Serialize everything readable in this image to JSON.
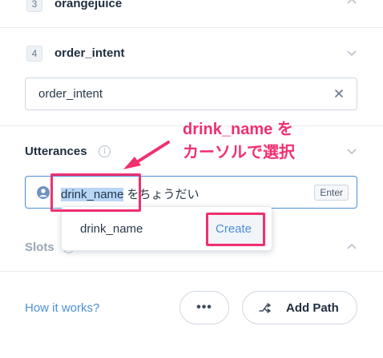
{
  "steps": [
    {
      "number": "3",
      "name": "orangejuice"
    },
    {
      "number": "4",
      "name": "order_intent"
    }
  ],
  "intent_field": {
    "value": "order_intent"
  },
  "utterances": {
    "label": "Utterances",
    "selected_text": "drink_name",
    "rest_text": " をちょうだい",
    "enter_key": "Enter"
  },
  "dropdown": {
    "item": "drink_name",
    "create_label": "Create"
  },
  "slots": {
    "label": "Slots"
  },
  "annotation": {
    "line1": "drink_name を",
    "line2": "カーソルで選択"
  },
  "footer": {
    "how_it_works": "How it works?",
    "more_label": "•••",
    "add_path_label": "Add Path"
  },
  "colors": {
    "accent": "#4a90d9",
    "annotation": "#f0306f",
    "selection": "#b8d6f5"
  },
  "icons": {
    "clear": "close-icon",
    "user": "user-icon",
    "info": "info-icon",
    "chevron": "chevron-icon",
    "add_path": "split-path-icon"
  }
}
